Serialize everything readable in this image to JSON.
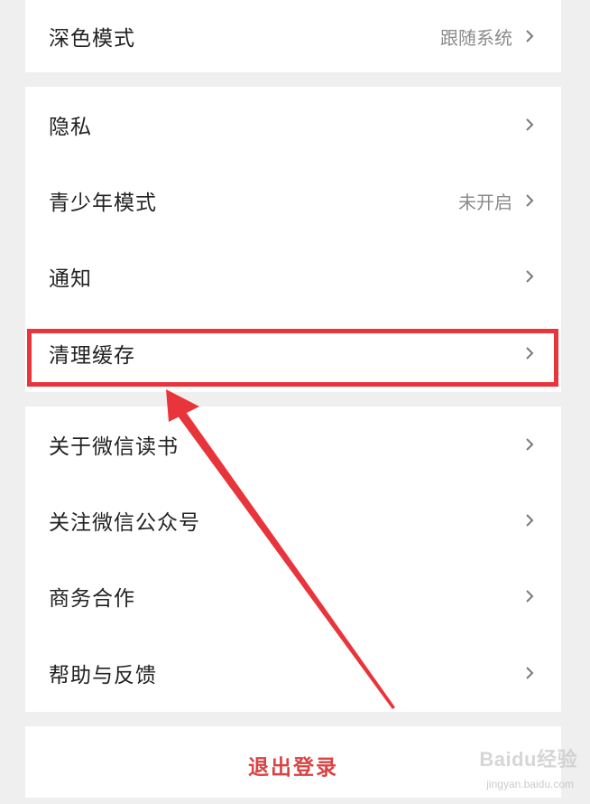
{
  "settings": {
    "dark_mode": {
      "label": "深色模式",
      "value": "跟随系统"
    },
    "privacy": {
      "label": "隐私"
    },
    "teen_mode": {
      "label": "青少年模式",
      "value": "未开启"
    },
    "notifications": {
      "label": "通知"
    },
    "clear_cache": {
      "label": "清理缓存"
    },
    "about": {
      "label": "关于微信读书"
    },
    "follow": {
      "label": "关注微信公众号"
    },
    "business": {
      "label": "商务合作"
    },
    "help": {
      "label": "帮助与反馈"
    }
  },
  "logout": {
    "label": "退出登录"
  },
  "watermark": {
    "brand": "Baidu经验",
    "url": "jingyan.baidu.com"
  },
  "colors": {
    "highlight": "#e8353b",
    "logout_text": "#d94343",
    "background": "#efefef"
  },
  "icons": {
    "row_chevron": "chevron-right-icon"
  }
}
